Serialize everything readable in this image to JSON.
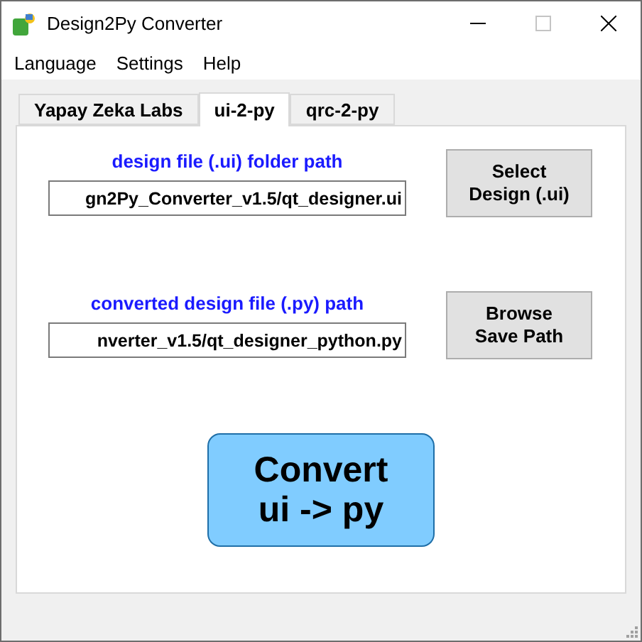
{
  "window": {
    "title": "Design2Py Converter",
    "maximize_disabled": true
  },
  "menu": [
    "Language",
    "Settings",
    "Help"
  ],
  "tabs": [
    {
      "label": "Yapay Zeka Labs",
      "selected": false
    },
    {
      "label": "ui-2-py",
      "selected": true
    },
    {
      "label": "qrc-2-py",
      "selected": false
    }
  ],
  "rows": [
    {
      "label": "design file (.ui) folder path",
      "value": "gn2Py_Converter_v1.5/qt_designer.ui",
      "button": "Select\nDesign (.ui)"
    },
    {
      "label": "converted design file (.py) path",
      "value": "nverter_v1.5/qt_designer_python.py",
      "button": "Browse\nSave Path"
    }
  ],
  "convert_button": "Convert\nui -> py"
}
